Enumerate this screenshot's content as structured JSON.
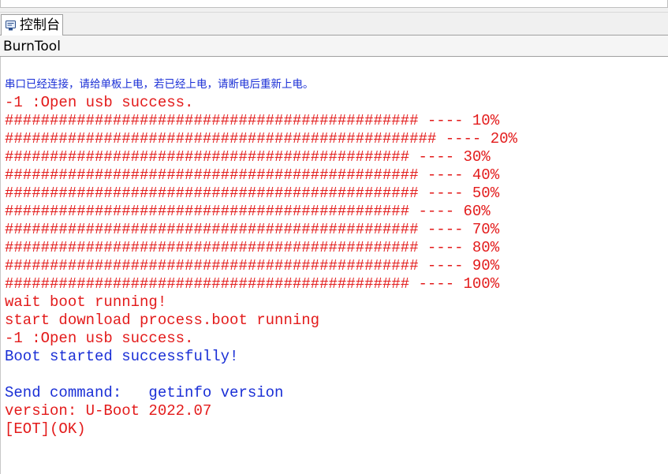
{
  "tab": {
    "label": "控制台"
  },
  "panel": {
    "title": "BurnTool"
  },
  "colors": {
    "error_text": "#e31b1b",
    "info_text": "#1a2fd6"
  },
  "console": {
    "lines": [
      {
        "text": "串口已经连接，请给单板上电，若已经上电，请断电后重新上电。",
        "color": "blue",
        "cjk": true
      },
      {
        "text": "-1 :Open usb success.",
        "color": "red"
      },
      {
        "text": "############################################## ---- 10%",
        "color": "red"
      },
      {
        "text": "################################################ ---- 20%",
        "color": "red"
      },
      {
        "text": "############################################# ---- 30%",
        "color": "red"
      },
      {
        "text": "############################################## ---- 40%",
        "color": "red"
      },
      {
        "text": "############################################## ---- 50%",
        "color": "red"
      },
      {
        "text": "############################################# ---- 60%",
        "color": "red"
      },
      {
        "text": "############################################## ---- 70%",
        "color": "red"
      },
      {
        "text": "############################################## ---- 80%",
        "color": "red"
      },
      {
        "text": "############################################## ---- 90%",
        "color": "red"
      },
      {
        "text": "############################################# ---- 100%",
        "color": "red"
      },
      {
        "text": "wait boot running!",
        "color": "red"
      },
      {
        "text": "start download process.boot running",
        "color": "red"
      },
      {
        "text": "-1 :Open usb success.",
        "color": "red"
      },
      {
        "text": "Boot started successfully!",
        "color": "blue"
      },
      {
        "text": "",
        "color": "blue"
      },
      {
        "text": "Send command:   getinfo version",
        "color": "blue"
      },
      {
        "text": "version: U-Boot 2022.07",
        "color": "red"
      },
      {
        "text": "[EOT](OK)",
        "color": "red"
      }
    ]
  }
}
